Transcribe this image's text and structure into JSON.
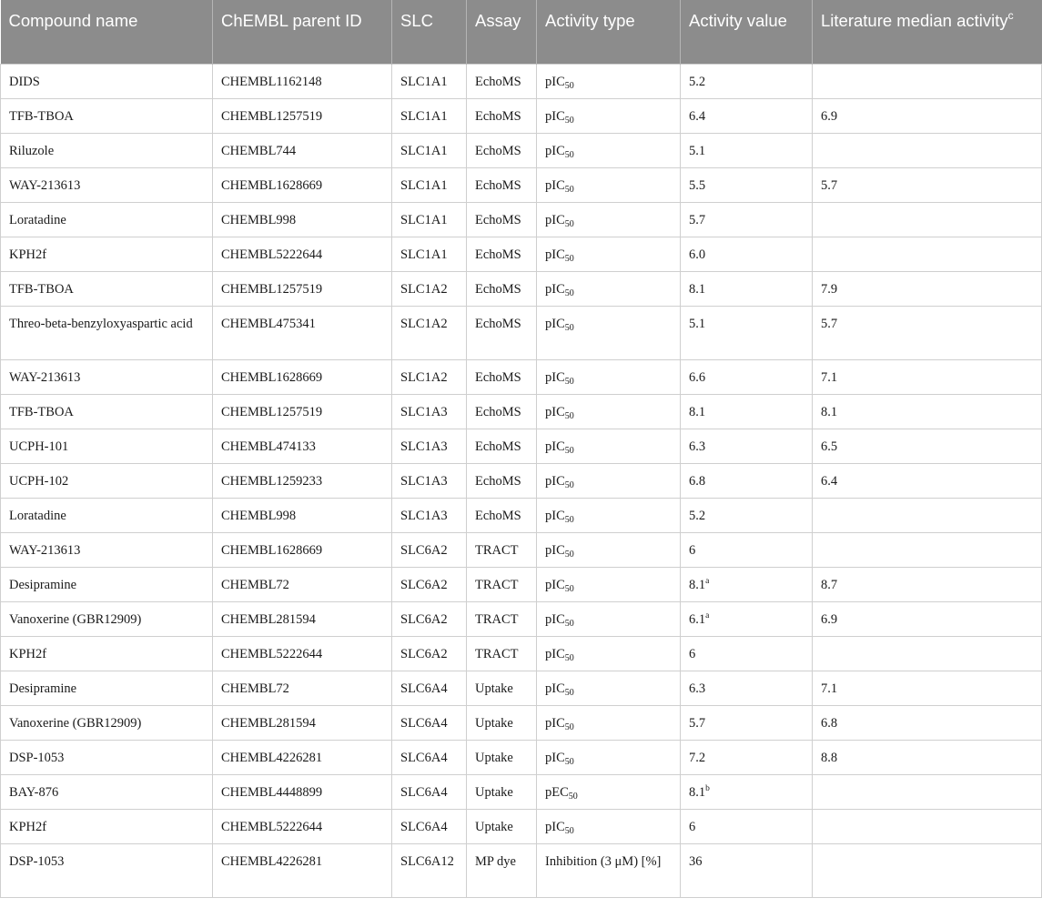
{
  "headers": {
    "compound": "Compound name",
    "chembl": "ChEMBL parent ID",
    "slc": "SLC",
    "assay": "Assay",
    "activity_type": "Activity type",
    "activity_value": "Activity value",
    "literature": "Literature median activity",
    "literature_sup": "c"
  },
  "rows": [
    {
      "compound": "DIDS",
      "chembl": "CHEMBL1162148",
      "slc": "SLC1A1",
      "assay": "EchoMS",
      "type": "pIC",
      "type_sub": "50",
      "value": "5.2",
      "value_sup": "",
      "lit": ""
    },
    {
      "compound": "TFB-TBOA",
      "chembl": "CHEMBL1257519",
      "slc": "SLC1A1",
      "assay": "EchoMS",
      "type": "pIC",
      "type_sub": "50",
      "value": "6.4",
      "value_sup": "",
      "lit": "6.9"
    },
    {
      "compound": "Riluzole",
      "chembl": "CHEMBL744",
      "slc": "SLC1A1",
      "assay": "EchoMS",
      "type": "pIC",
      "type_sub": "50",
      "value": "5.1",
      "value_sup": "",
      "lit": ""
    },
    {
      "compound": "WAY-213613",
      "chembl": "CHEMBL1628669",
      "slc": "SLC1A1",
      "assay": "EchoMS",
      "type": "pIC",
      "type_sub": "50",
      "value": "5.5",
      "value_sup": "",
      "lit": "5.7"
    },
    {
      "compound": "Loratadine",
      "chembl": "CHEMBL998",
      "slc": "SLC1A1",
      "assay": "EchoMS",
      "type": "pIC",
      "type_sub": "50",
      "value": "5.7",
      "value_sup": "",
      "lit": ""
    },
    {
      "compound": "KPH2f",
      "chembl": "CHEMBL5222644",
      "slc": "SLC1A1",
      "assay": "EchoMS",
      "type": "pIC",
      "type_sub": "50",
      "value": "6.0",
      "value_sup": "",
      "lit": ""
    },
    {
      "compound": "TFB-TBOA",
      "chembl": "CHEMBL1257519",
      "slc": "SLC1A2",
      "assay": "EchoMS",
      "type": "pIC",
      "type_sub": "50",
      "value": "8.1",
      "value_sup": "",
      "lit": "7.9"
    },
    {
      "compound": "Threo-beta-benzyloxyaspartic acid",
      "chembl": "CHEMBL475341",
      "slc": "SLC1A2",
      "assay": "EchoMS",
      "type": "pIC",
      "type_sub": "50",
      "value": "5.1",
      "value_sup": "",
      "lit": "5.7",
      "tall": true
    },
    {
      "compound": "WAY-213613",
      "chembl": "CHEMBL1628669",
      "slc": "SLC1A2",
      "assay": "EchoMS",
      "type": "pIC",
      "type_sub": "50",
      "value": "6.6",
      "value_sup": "",
      "lit": "7.1"
    },
    {
      "compound": "TFB-TBOA",
      "chembl": "CHEMBL1257519",
      "slc": "SLC1A3",
      "assay": "EchoMS",
      "type": "pIC",
      "type_sub": "50",
      "value": "8.1",
      "value_sup": "",
      "lit": "8.1"
    },
    {
      "compound": "UCPH-101",
      "chembl": "CHEMBL474133",
      "slc": "SLC1A3",
      "assay": "EchoMS",
      "type": "pIC",
      "type_sub": "50",
      "value": "6.3",
      "value_sup": "",
      "lit": "6.5"
    },
    {
      "compound": "UCPH-102",
      "chembl": "CHEMBL1259233",
      "slc": "SLC1A3",
      "assay": "EchoMS",
      "type": "pIC",
      "type_sub": "50",
      "value": "6.8",
      "value_sup": "",
      "lit": "6.4"
    },
    {
      "compound": "Loratadine",
      "chembl": "CHEMBL998",
      "slc": "SLC1A3",
      "assay": "EchoMS",
      "type": "pIC",
      "type_sub": "50",
      "value": "5.2",
      "value_sup": "",
      "lit": ""
    },
    {
      "compound": "WAY-213613",
      "chembl": "CHEMBL1628669",
      "slc": "SLC6A2",
      "assay": "TRACT",
      "type": "pIC",
      "type_sub": "50",
      "value": "6",
      "value_sup": "",
      "lit": ""
    },
    {
      "compound": "Desipramine",
      "chembl": "CHEMBL72",
      "slc": "SLC6A2",
      "assay": "TRACT",
      "type": "pIC",
      "type_sub": "50",
      "value": "8.1",
      "value_sup": "a",
      "lit": "8.7"
    },
    {
      "compound": "Vanoxerine (GBR12909)",
      "chembl": "CHEMBL281594",
      "slc": "SLC6A2",
      "assay": "TRACT",
      "type": "pIC",
      "type_sub": "50",
      "value": "6.1",
      "value_sup": "a",
      "lit": "6.9"
    },
    {
      "compound": "KPH2f",
      "chembl": "CHEMBL5222644",
      "slc": "SLC6A2",
      "assay": "TRACT",
      "type": "pIC",
      "type_sub": "50",
      "value": "6",
      "value_sup": "",
      "lit": ""
    },
    {
      "compound": "Desipramine",
      "chembl": "CHEMBL72",
      "slc": "SLC6A4",
      "assay": "Uptake",
      "type": "pIC",
      "type_sub": "50",
      "value": "6.3",
      "value_sup": "",
      "lit": "7.1"
    },
    {
      "compound": "Vanoxerine (GBR12909)",
      "chembl": "CHEMBL281594",
      "slc": "SLC6A4",
      "assay": "Uptake",
      "type": "pIC",
      "type_sub": "50",
      "value": "5.7",
      "value_sup": "",
      "lit": "6.8"
    },
    {
      "compound": "DSP-1053",
      "chembl": "CHEMBL4226281",
      "slc": "SLC6A4",
      "assay": "Uptake",
      "type": "pIC",
      "type_sub": "50",
      "value": "7.2",
      "value_sup": "",
      "lit": "8.8"
    },
    {
      "compound": "BAY-876",
      "chembl": "CHEMBL4448899",
      "slc": "SLC6A4",
      "assay": "Uptake",
      "type": "pEC",
      "type_sub": "50",
      "value": "8.1",
      "value_sup": "b",
      "lit": ""
    },
    {
      "compound": "KPH2f",
      "chembl": "CHEMBL5222644",
      "slc": "SLC6A4",
      "assay": "Uptake",
      "type": "pIC",
      "type_sub": "50",
      "value": "6",
      "value_sup": "",
      "lit": ""
    },
    {
      "compound": "DSP-1053",
      "chembl": "CHEMBL4226281",
      "slc": "SLC6A12",
      "assay": "MP dye",
      "type": "Inhibition (3 μM) [%]",
      "type_sub": "",
      "value": "36",
      "value_sup": "",
      "lit": "",
      "tall": true
    }
  ]
}
